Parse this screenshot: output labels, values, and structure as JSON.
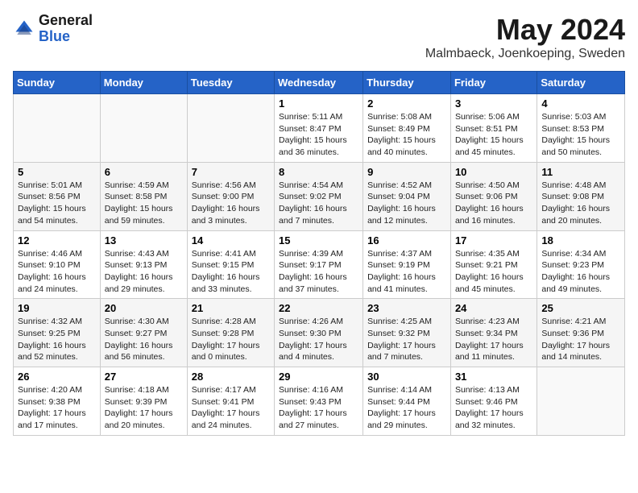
{
  "header": {
    "logo_general": "General",
    "logo_blue": "Blue",
    "month": "May 2024",
    "location": "Malmbaeck, Joenkoeping, Sweden"
  },
  "days_of_week": [
    "Sunday",
    "Monday",
    "Tuesday",
    "Wednesday",
    "Thursday",
    "Friday",
    "Saturday"
  ],
  "weeks": [
    [
      {
        "day": "",
        "info": ""
      },
      {
        "day": "",
        "info": ""
      },
      {
        "day": "",
        "info": ""
      },
      {
        "day": "1",
        "info": "Sunrise: 5:11 AM\nSunset: 8:47 PM\nDaylight: 15 hours\nand 36 minutes."
      },
      {
        "day": "2",
        "info": "Sunrise: 5:08 AM\nSunset: 8:49 PM\nDaylight: 15 hours\nand 40 minutes."
      },
      {
        "day": "3",
        "info": "Sunrise: 5:06 AM\nSunset: 8:51 PM\nDaylight: 15 hours\nand 45 minutes."
      },
      {
        "day": "4",
        "info": "Sunrise: 5:03 AM\nSunset: 8:53 PM\nDaylight: 15 hours\nand 50 minutes."
      }
    ],
    [
      {
        "day": "5",
        "info": "Sunrise: 5:01 AM\nSunset: 8:56 PM\nDaylight: 15 hours\nand 54 minutes."
      },
      {
        "day": "6",
        "info": "Sunrise: 4:59 AM\nSunset: 8:58 PM\nDaylight: 15 hours\nand 59 minutes."
      },
      {
        "day": "7",
        "info": "Sunrise: 4:56 AM\nSunset: 9:00 PM\nDaylight: 16 hours\nand 3 minutes."
      },
      {
        "day": "8",
        "info": "Sunrise: 4:54 AM\nSunset: 9:02 PM\nDaylight: 16 hours\nand 7 minutes."
      },
      {
        "day": "9",
        "info": "Sunrise: 4:52 AM\nSunset: 9:04 PM\nDaylight: 16 hours\nand 12 minutes."
      },
      {
        "day": "10",
        "info": "Sunrise: 4:50 AM\nSunset: 9:06 PM\nDaylight: 16 hours\nand 16 minutes."
      },
      {
        "day": "11",
        "info": "Sunrise: 4:48 AM\nSunset: 9:08 PM\nDaylight: 16 hours\nand 20 minutes."
      }
    ],
    [
      {
        "day": "12",
        "info": "Sunrise: 4:46 AM\nSunset: 9:10 PM\nDaylight: 16 hours\nand 24 minutes."
      },
      {
        "day": "13",
        "info": "Sunrise: 4:43 AM\nSunset: 9:13 PM\nDaylight: 16 hours\nand 29 minutes."
      },
      {
        "day": "14",
        "info": "Sunrise: 4:41 AM\nSunset: 9:15 PM\nDaylight: 16 hours\nand 33 minutes."
      },
      {
        "day": "15",
        "info": "Sunrise: 4:39 AM\nSunset: 9:17 PM\nDaylight: 16 hours\nand 37 minutes."
      },
      {
        "day": "16",
        "info": "Sunrise: 4:37 AM\nSunset: 9:19 PM\nDaylight: 16 hours\nand 41 minutes."
      },
      {
        "day": "17",
        "info": "Sunrise: 4:35 AM\nSunset: 9:21 PM\nDaylight: 16 hours\nand 45 minutes."
      },
      {
        "day": "18",
        "info": "Sunrise: 4:34 AM\nSunset: 9:23 PM\nDaylight: 16 hours\nand 49 minutes."
      }
    ],
    [
      {
        "day": "19",
        "info": "Sunrise: 4:32 AM\nSunset: 9:25 PM\nDaylight: 16 hours\nand 52 minutes."
      },
      {
        "day": "20",
        "info": "Sunrise: 4:30 AM\nSunset: 9:27 PM\nDaylight: 16 hours\nand 56 minutes."
      },
      {
        "day": "21",
        "info": "Sunrise: 4:28 AM\nSunset: 9:28 PM\nDaylight: 17 hours\nand 0 minutes."
      },
      {
        "day": "22",
        "info": "Sunrise: 4:26 AM\nSunset: 9:30 PM\nDaylight: 17 hours\nand 4 minutes."
      },
      {
        "day": "23",
        "info": "Sunrise: 4:25 AM\nSunset: 9:32 PM\nDaylight: 17 hours\nand 7 minutes."
      },
      {
        "day": "24",
        "info": "Sunrise: 4:23 AM\nSunset: 9:34 PM\nDaylight: 17 hours\nand 11 minutes."
      },
      {
        "day": "25",
        "info": "Sunrise: 4:21 AM\nSunset: 9:36 PM\nDaylight: 17 hours\nand 14 minutes."
      }
    ],
    [
      {
        "day": "26",
        "info": "Sunrise: 4:20 AM\nSunset: 9:38 PM\nDaylight: 17 hours\nand 17 minutes."
      },
      {
        "day": "27",
        "info": "Sunrise: 4:18 AM\nSunset: 9:39 PM\nDaylight: 17 hours\nand 20 minutes."
      },
      {
        "day": "28",
        "info": "Sunrise: 4:17 AM\nSunset: 9:41 PM\nDaylight: 17 hours\nand 24 minutes."
      },
      {
        "day": "29",
        "info": "Sunrise: 4:16 AM\nSunset: 9:43 PM\nDaylight: 17 hours\nand 27 minutes."
      },
      {
        "day": "30",
        "info": "Sunrise: 4:14 AM\nSunset: 9:44 PM\nDaylight: 17 hours\nand 29 minutes."
      },
      {
        "day": "31",
        "info": "Sunrise: 4:13 AM\nSunset: 9:46 PM\nDaylight: 17 hours\nand 32 minutes."
      },
      {
        "day": "",
        "info": ""
      }
    ]
  ]
}
